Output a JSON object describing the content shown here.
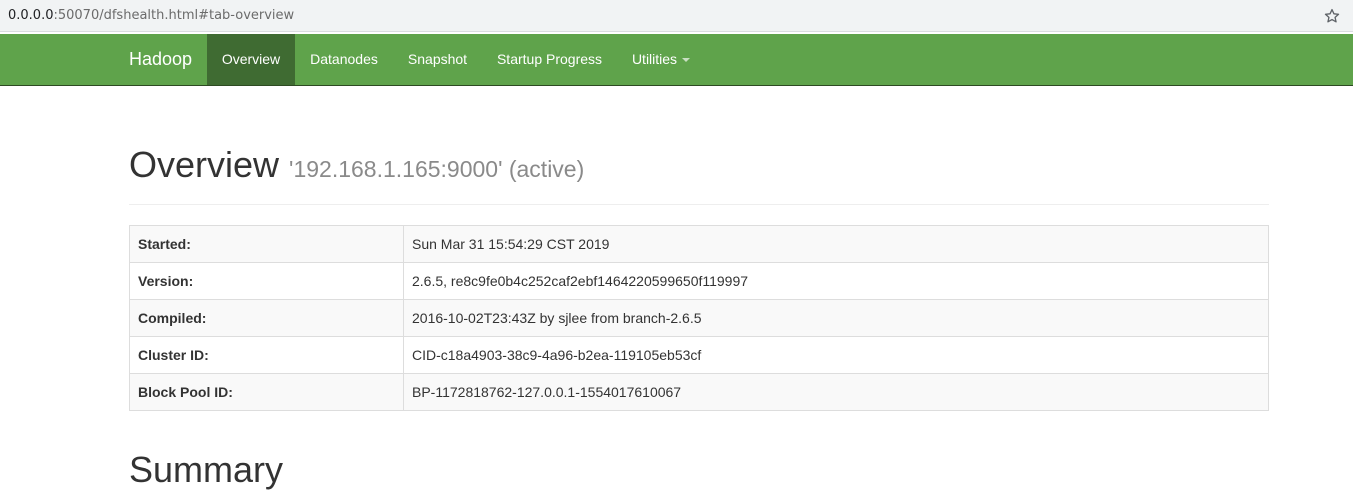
{
  "browser": {
    "url_host": "0.0.0.0",
    "url_rest": ":50070/dfshealth.html#tab-overview",
    "bookmark_icon": "star-icon"
  },
  "navbar": {
    "brand": "Hadoop",
    "items": [
      {
        "label": "Overview",
        "active": true
      },
      {
        "label": "Datanodes"
      },
      {
        "label": "Snapshot"
      },
      {
        "label": "Startup Progress"
      },
      {
        "label": "Utilities",
        "dropdown": true
      }
    ],
    "colors": {
      "background": "#5fa34b",
      "active": "#3f6b32"
    }
  },
  "header": {
    "title": "Overview",
    "subtitle": "'192.168.1.165:9000' (active)"
  },
  "info_table": [
    {
      "key": "Started:",
      "value": "Sun Mar 31 15:54:29 CST 2019"
    },
    {
      "key": "Version:",
      "value": "2.6.5, re8c9fe0b4c252caf2ebf1464220599650f119997"
    },
    {
      "key": "Compiled:",
      "value": "2016-10-02T23:43Z by sjlee from branch-2.6.5"
    },
    {
      "key": "Cluster ID:",
      "value": "CID-c18a4903-38c9-4a96-b2ea-119105eb53cf"
    },
    {
      "key": "Block Pool ID:",
      "value": "BP-1172818762-127.0.0.1-1554017610067"
    }
  ],
  "summary": {
    "title": "Summary"
  }
}
